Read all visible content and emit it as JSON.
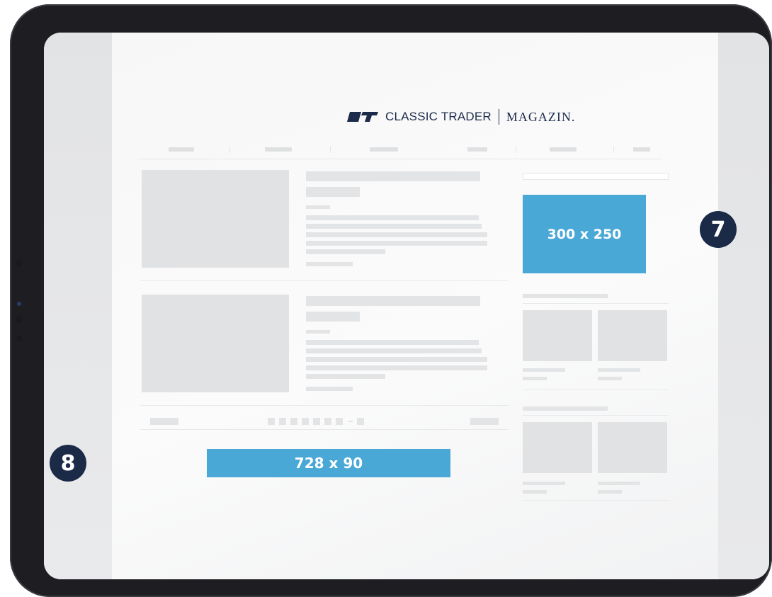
{
  "brand": {
    "name": "CLASSIC TRADER",
    "section": "MAGAZIN."
  },
  "ads": {
    "rectangle_label": "300 x 250",
    "leaderboard_label": "728 x 90"
  },
  "markers": {
    "right_number": "7",
    "left_number": "8"
  },
  "colors": {
    "ad_blue": "#4aa8d6",
    "badge_navy": "#1b2a47",
    "brand_navy": "#1c2b4a"
  }
}
